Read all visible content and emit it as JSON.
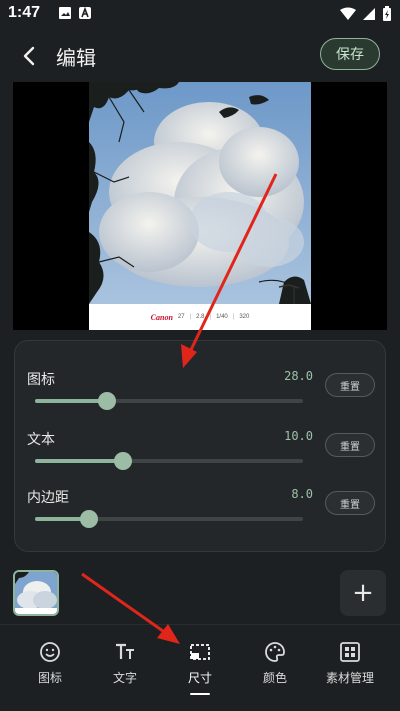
{
  "status_bar": {
    "time": "1:47"
  },
  "header": {
    "title": "编辑",
    "save_label": "保存"
  },
  "preview": {
    "caption": {
      "brand": "Canon",
      "items": [
        "27",
        "2.8",
        "1/40",
        "320"
      ]
    }
  },
  "panel": {
    "sliders": [
      {
        "label": "图标",
        "value_text": "28.0",
        "fraction": 0.27,
        "reset_label": "重置"
      },
      {
        "label": "文本",
        "value_text": "10.0",
        "fraction": 0.33,
        "reset_label": "重置"
      },
      {
        "label": "内边距",
        "value_text": "8.0",
        "fraction": 0.2,
        "reset_label": "重置"
      }
    ]
  },
  "thumbs": {
    "add_label": "+"
  },
  "nav": {
    "items": [
      {
        "label": "图标",
        "icon": "smiley-icon"
      },
      {
        "label": "文字",
        "icon": "text-tt-icon"
      },
      {
        "label": "尺寸",
        "icon": "crop-frame-icon",
        "active": true
      },
      {
        "label": "颜色",
        "icon": "palette-icon"
      },
      {
        "label": "素材管理",
        "icon": "grid-icon"
      }
    ]
  },
  "colors": {
    "background": "#1d2022",
    "panel": "#24272a",
    "accent": "#8fb49c",
    "annotation_arrow": "#e0261b"
  }
}
